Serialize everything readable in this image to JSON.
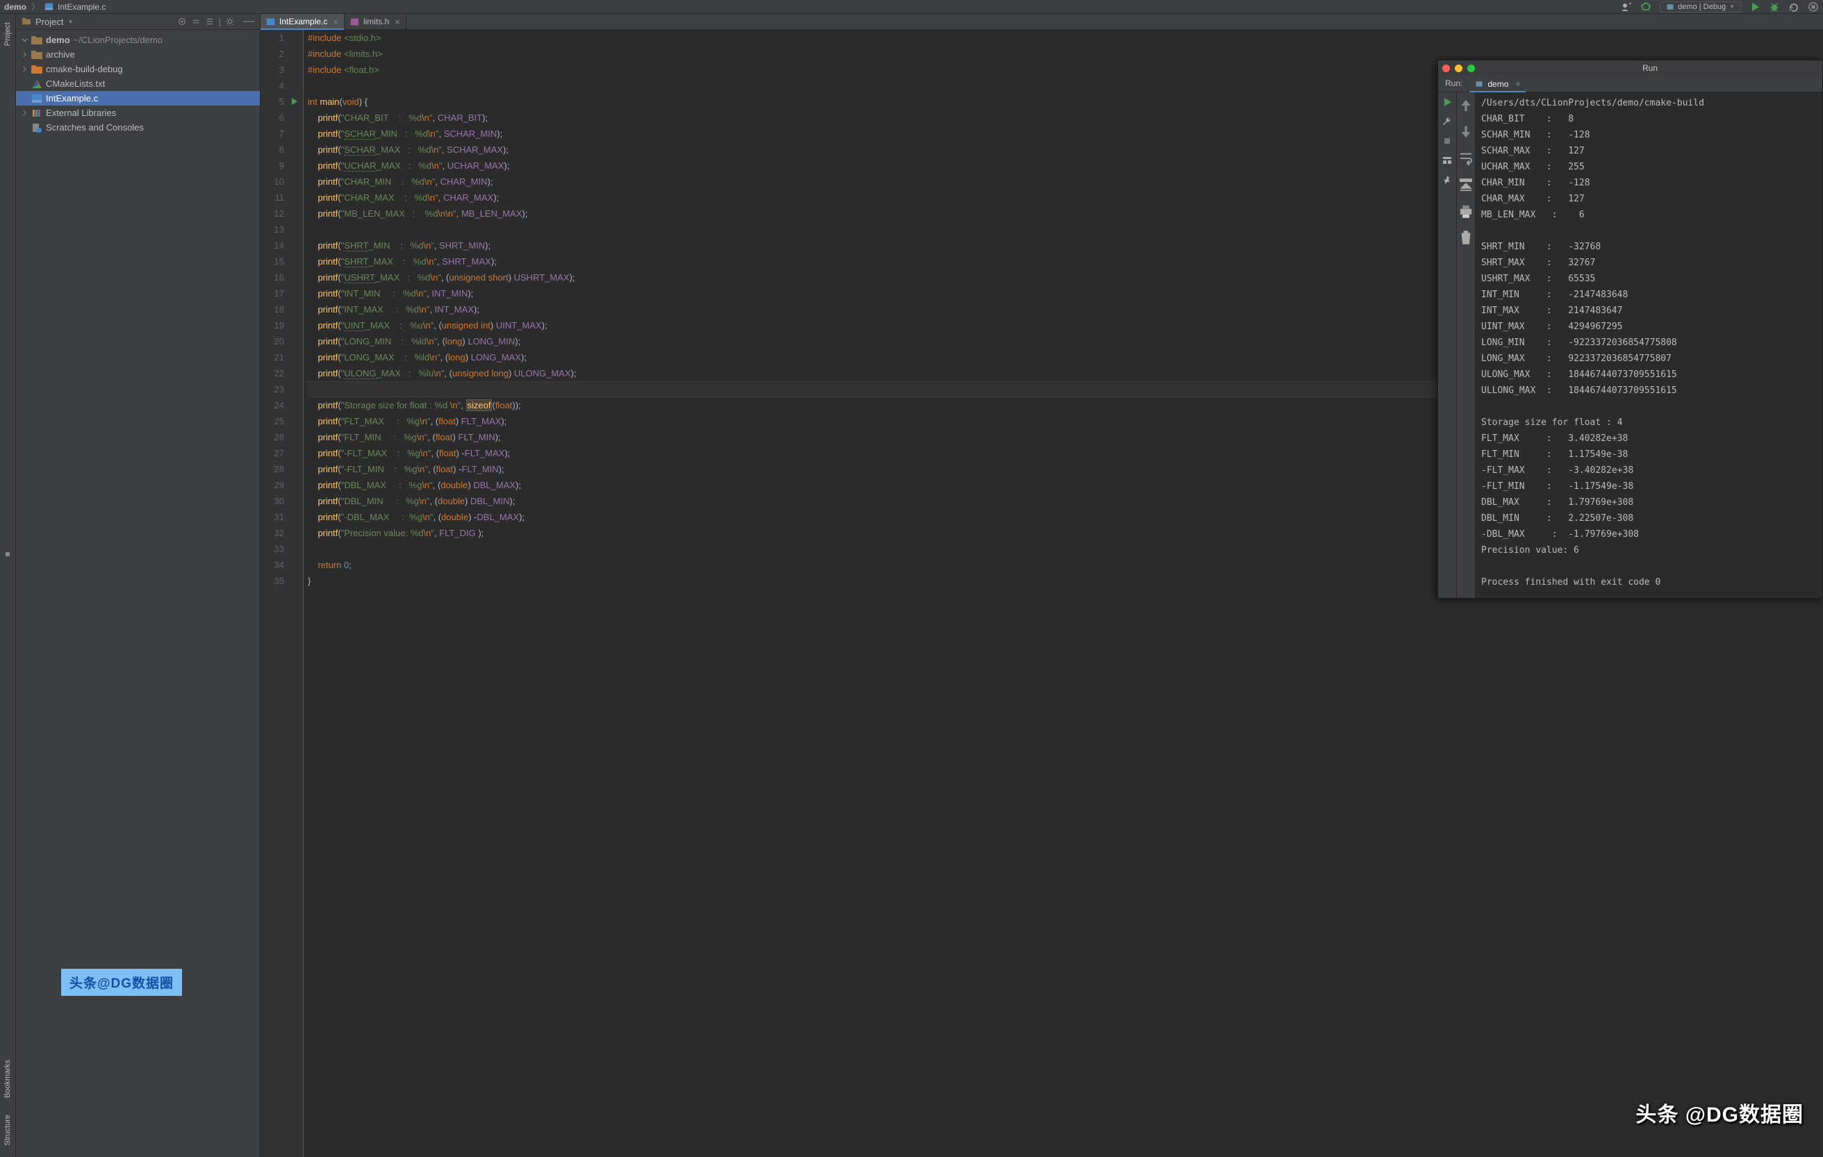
{
  "breadcrumb": {
    "root": "demo",
    "file": "IntExample.c"
  },
  "topRight": {
    "config": "demo | Debug"
  },
  "projectPanel": {
    "title": "Project",
    "nodes": {
      "demo": {
        "label": "demo",
        "path": "~/CLionProjects/demo"
      },
      "archive": {
        "label": "archive"
      },
      "cbd": {
        "label": "cmake-build-debug"
      },
      "cmakelists": {
        "label": "CMakeLists.txt"
      },
      "intexample": {
        "label": "IntExample.c"
      },
      "extlib": {
        "label": "External Libraries"
      },
      "scratches": {
        "label": "Scratches and Consoles"
      }
    }
  },
  "leftTabs": {
    "project": "Project",
    "bookmarks": "Bookmarks",
    "structure": "Structure"
  },
  "editorTabs": {
    "t1": "IntExample.c",
    "t2": "limits.h"
  },
  "code": {
    "lines": [
      {
        "n": 1,
        "html": "<span class='k-pre'>#include</span> <span class='k-inc'>&lt;stdio.h&gt;</span>"
      },
      {
        "n": 2,
        "html": "<span class='k-pre'>#include</span> <span class='k-inc'>&lt;limits.h&gt;</span>"
      },
      {
        "n": 3,
        "html": "<span class='k-pre'>#include</span> <span class='k-inc'>&lt;float.h&gt;</span>"
      },
      {
        "n": 4,
        "html": ""
      },
      {
        "n": 5,
        "html": "<span class='k-key'>int</span> <span class='k-fn'>main</span>(<span class='k-key'>void</span>) {",
        "run": true
      },
      {
        "n": 6,
        "html": "    <span class='k-fn'>printf</span>(<span class='k-str'>\"CHAR_BIT    :   %d</span><span class='k-key'>\\n</span><span class='k-str'>\"</span>, <span class='k-id'>CHAR_BIT</span>);"
      },
      {
        "n": 7,
        "html": "    <span class='k-fn'>printf</span>(<span class='k-str'>\"<span class='k-spell'>SCHAR</span>_MIN   :   %d</span><span class='k-key'>\\n</span><span class='k-str'>\"</span>, <span class='k-id'>SCHAR_MIN</span>);"
      },
      {
        "n": 8,
        "html": "    <span class='k-fn'>printf</span>(<span class='k-str'>\"<span class='k-spell'>SCHAR</span>_MAX   :   %d</span><span class='k-key'>\\n</span><span class='k-str'>\"</span>, <span class='k-id'>SCHAR_MAX</span>);"
      },
      {
        "n": 9,
        "html": "    <span class='k-fn'>printf</span>(<span class='k-str'>\"<span class='k-spell'>UCHAR</span>_MAX   :   %d</span><span class='k-key'>\\n</span><span class='k-str'>\"</span>, <span class='k-id'>UCHAR_MAX</span>);"
      },
      {
        "n": 10,
        "html": "    <span class='k-fn'>printf</span>(<span class='k-str'>\"CHAR_MIN    :   %d</span><span class='k-key'>\\n</span><span class='k-str'>\"</span>, <span class='k-id'>CHAR_MIN</span>);"
      },
      {
        "n": 11,
        "html": "    <span class='k-fn'>printf</span>(<span class='k-str'>\"CHAR_MAX    :   %d</span><span class='k-key'>\\n</span><span class='k-str'>\"</span>, <span class='k-id'>CHAR_MAX</span>);"
      },
      {
        "n": 12,
        "html": "    <span class='k-fn'>printf</span>(<span class='k-str'>\"MB_LEN_MAX   :    %d</span><span class='k-key'>\\n\\n</span><span class='k-str'>\"</span>, <span class='k-id'>MB_LEN_MAX</span>);"
      },
      {
        "n": 13,
        "html": ""
      },
      {
        "n": 14,
        "html": "    <span class='k-fn'>printf</span>(<span class='k-str'>\"<span class='k-spell'>SHRT</span>_MIN    :   %d</span><span class='k-key'>\\n</span><span class='k-str'>\"</span>, <span class='k-id'>SHRT_MIN</span>);"
      },
      {
        "n": 15,
        "html": "    <span class='k-fn'>printf</span>(<span class='k-str'>\"<span class='k-spell'>SHRT</span>_MAX    :   %d</span><span class='k-key'>\\n</span><span class='k-str'>\"</span>, <span class='k-id'>SHRT_MAX</span>);"
      },
      {
        "n": 16,
        "html": "    <span class='k-fn'>printf</span>(<span class='k-str'>\"<span class='k-spell'>USHRT</span>_MAX   :   %d</span><span class='k-key'>\\n</span><span class='k-str'>\"</span>, (<span class='k-key'>unsigned short</span>) <span class='k-id'>USHRT_MAX</span>);"
      },
      {
        "n": 17,
        "html": "    <span class='k-fn'>printf</span>(<span class='k-str'>\"INT_MIN     :   %d</span><span class='k-key'>\\n</span><span class='k-str'>\"</span>, <span class='k-id'>INT_MIN</span>);"
      },
      {
        "n": 18,
        "html": "    <span class='k-fn'>printf</span>(<span class='k-str'>\"INT_MAX     :   %d</span><span class='k-key'>\\n</span><span class='k-str'>\"</span>, <span class='k-id'>INT_MAX</span>);"
      },
      {
        "n": 19,
        "html": "    <span class='k-fn'>printf</span>(<span class='k-str'>\"<span class='k-spell'>UINT</span>_MAX    :   %u</span><span class='k-key'>\\n</span><span class='k-str'>\"</span>, (<span class='k-key'>unsigned int</span>) <span class='k-id'>UINT_MAX</span>);"
      },
      {
        "n": 20,
        "html": "    <span class='k-fn'>printf</span>(<span class='k-str'>\"LONG_MIN    :   %ld</span><span class='k-key'>\\n</span><span class='k-str'>\"</span>, (<span class='k-key'>long</span>) <span class='k-id'>LONG_MIN</span>);"
      },
      {
        "n": 21,
        "html": "    <span class='k-fn'>printf</span>(<span class='k-str'>\"LONG_MAX    :   %ld</span><span class='k-key'>\\n</span><span class='k-str'>\"</span>, (<span class='k-key'>long</span>) <span class='k-id'>LONG_MAX</span>);"
      },
      {
        "n": 22,
        "html": "    <span class='k-fn'>printf</span>(<span class='k-str'>\"<span class='k-spell'>ULONG</span>_MAX   :   %lu</span><span class='k-key'>\\n</span><span class='k-str'>\"</span>, (<span class='k-key'>unsigned long</span>) <span class='k-id'>ULONG_MAX</span>);"
      },
      {
        "n": 23,
        "html": "",
        "current": true
      },
      {
        "n": 24,
        "html": "    <span class='k-fn'>printf</span>(<span class='k-str'>\"Storage size for float : %d </span><span class='k-key'>\\n</span><span class='k-str'>\"</span>, <span class='k-hl'>sizeof</span>(<span class='k-key'>float</span>));"
      },
      {
        "n": 25,
        "html": "    <span class='k-fn'>printf</span>(<span class='k-str'>\"FLT_MAX     :   %g</span><span class='k-key'>\\n</span><span class='k-str'>\"</span>, (<span class='k-key'>float</span>) <span class='k-id'>FLT_MAX</span>);"
      },
      {
        "n": 26,
        "html": "    <span class='k-fn'>printf</span>(<span class='k-str'>\"FLT_MIN     :   %g</span><span class='k-key'>\\n</span><span class='k-str'>\"</span>, (<span class='k-key'>float</span>) <span class='k-id'>FLT_MIN</span>);"
      },
      {
        "n": 27,
        "html": "    <span class='k-fn'>printf</span>(<span class='k-str'>\"-FLT_MAX    :   %g</span><span class='k-key'>\\n</span><span class='k-str'>\"</span>, (<span class='k-key'>float</span>) -<span class='k-id'>FLT_MAX</span>);"
      },
      {
        "n": 28,
        "html": "    <span class='k-fn'>printf</span>(<span class='k-str'>\"-FLT_MIN    :   %g</span><span class='k-key'>\\n</span><span class='k-str'>\"</span>, (<span class='k-key'>float</span>) -<span class='k-id'>FLT_MIN</span>);"
      },
      {
        "n": 29,
        "html": "    <span class='k-fn'>printf</span>(<span class='k-str'>\"DBL_MAX     :   %g</span><span class='k-key'>\\n</span><span class='k-str'>\"</span>, (<span class='k-key'>double</span>) <span class='k-id'>DBL_MAX</span>);"
      },
      {
        "n": 30,
        "html": "    <span class='k-fn'>printf</span>(<span class='k-str'>\"DBL_MIN     :   %g</span><span class='k-key'>\\n</span><span class='k-str'>\"</span>, (<span class='k-key'>double</span>) <span class='k-id'>DBL_MIN</span>);"
      },
      {
        "n": 31,
        "html": "    <span class='k-fn'>printf</span>(<span class='k-str'>\"-DBL_MAX     :  %g</span><span class='k-key'>\\n</span><span class='k-str'>\"</span>, (<span class='k-key'>double</span>) -<span class='k-id'>DBL_MAX</span>);"
      },
      {
        "n": 32,
        "html": "    <span class='k-fn'>printf</span>(<span class='k-str'>\"Precision value: %d</span><span class='k-key'>\\n</span><span class='k-str'>\"</span>, <span class='k-id'>FLT_DIG</span> );"
      },
      {
        "n": 33,
        "html": ""
      },
      {
        "n": 34,
        "html": "    <span class='k-key'>return</span> <span class='k-num'>0</span>;"
      },
      {
        "n": 35,
        "html": "}"
      }
    ]
  },
  "run": {
    "title": "Run",
    "tabLabel": "Run:",
    "configTab": "demo",
    "output": "/Users/dts/CLionProjects/demo/cmake-build\nCHAR_BIT    :   8\nSCHAR_MIN   :   -128\nSCHAR_MAX   :   127\nUCHAR_MAX   :   255\nCHAR_MIN    :   -128\nCHAR_MAX    :   127\nMB_LEN_MAX   :    6\n\nSHRT_MIN    :   -32768\nSHRT_MAX    :   32767\nUSHRT_MAX   :   65535\nINT_MIN     :   -2147483648\nINT_MAX     :   2147483647\nUINT_MAX    :   4294967295\nLONG_MIN    :   -9223372036854775808\nLONG_MAX    :   9223372036854775807\nULONG_MAX   :   18446744073709551615\nULLONG_MAX  :   18446744073709551615\n\nStorage size for float : 4\nFLT_MAX     :   3.40282e+38\nFLT_MIN     :   1.17549e-38\n-FLT_MAX    :   -3.40282e+38\n-FLT_MIN    :   -1.17549e-38\nDBL_MAX     :   1.79769e+308\nDBL_MIN     :   2.22507e-308\n-DBL_MAX     :  -1.79769e+308\nPrecision value: 6\n\nProcess finished with exit code 0"
  },
  "watermark": {
    "w1": "头条@DG数据圈",
    "w2": "头条 @DG数据圈"
  }
}
